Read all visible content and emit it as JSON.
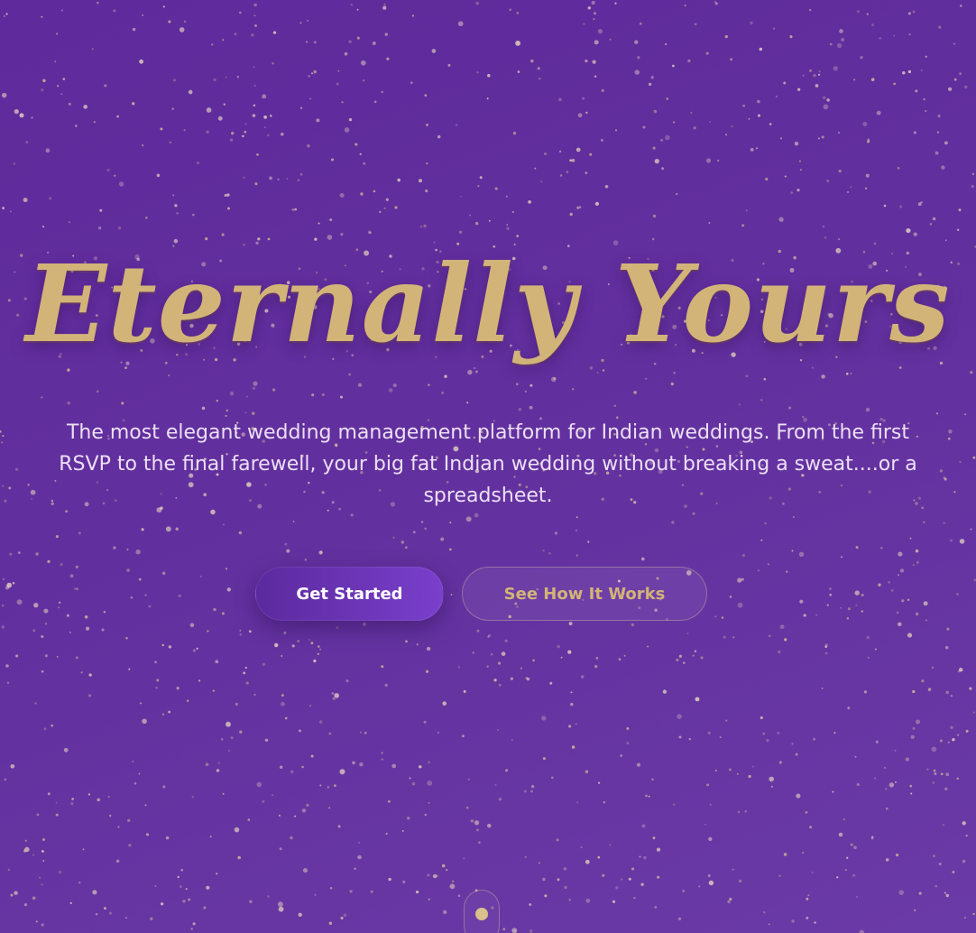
{
  "hero": {
    "title": "Eternally Yours",
    "tagline": "The most elegant wedding management platform for Indian weddings. From the first RSVP to the final farewell, your big fat Indian wedding without breaking a sweat....or a spreadsheet.",
    "primary_button": "Get Started",
    "secondary_button": "See How It Works"
  },
  "colors": {
    "background": "#62309e",
    "gold": "#d2b478",
    "primary_button": "#7a3fcc",
    "tagline_text": "#ece0f5"
  },
  "icons": {
    "scroll_indicator": "scroll-mouse-icon",
    "background_decoration": "gold-sparkles"
  }
}
